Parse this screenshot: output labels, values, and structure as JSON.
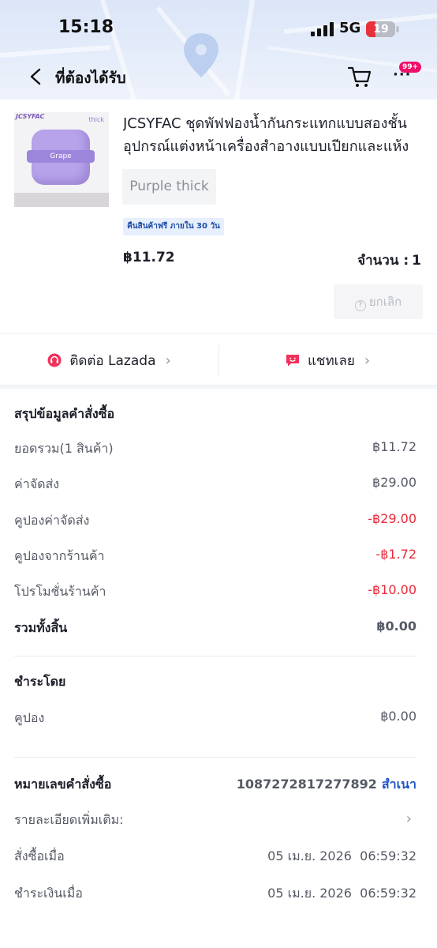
{
  "status_bar": {
    "time": "15:18",
    "network": "5G",
    "battery": "19"
  },
  "nav": {
    "title": "ที่ต้องได้รับ",
    "more_badge": "99+"
  },
  "product": {
    "image_brand": "JCSYFAC",
    "image_variant": "thick",
    "image_puff_label": "Grape",
    "title": "JCSYFAC ชุดพัฟฟองน้ำกันกระแทกแบบสองชั้น อุปกรณ์แต่งหน้าเครื่องสำอางแบบเปียกและแห้ง",
    "variant": "Purple thick",
    "return_tag": "คืนสินค้าฟรี ภายใน 30 วัน",
    "price": "฿11.72",
    "quantity_label": "จำนวน :",
    "quantity": "1",
    "cancel_label": "ยกเลิก"
  },
  "contact": {
    "lazada_label": "ติดต่อ Lazada",
    "chat_label": "แชทเลย"
  },
  "summary": {
    "title": "สรุปข้อมูลคำสั่งซื้อ",
    "rows": [
      {
        "label": "ยอดรวม(1 สินค้า)",
        "value": "฿11.72"
      },
      {
        "label": "ค่าจัดส่ง",
        "value": "฿29.00"
      },
      {
        "label": "คูปองค่าจัดส่ง",
        "value": "-฿29.00"
      },
      {
        "label": "คูปองจากร้านค้า",
        "value": "-฿1.72"
      },
      {
        "label": "โปรโมชั่นร้านค้า",
        "value": "-฿10.00"
      }
    ],
    "total_label": "รวมทั้งสิ้น",
    "total_value": "฿0.00"
  },
  "payment": {
    "title": "ชำระโดย",
    "method_label": "คูปอง",
    "method_value": "฿0.00"
  },
  "order": {
    "id_label": "หมายเลขคำสั่งซื้อ",
    "id_value": "1087272817277892",
    "copy_label": "สำเนา",
    "details_label": "รายละเอียดเพิ่มเติม:",
    "ordered_label": "สั่งซื้อเมื่อ",
    "ordered_value": "05 เม.ย. 2026  06:59:32",
    "paid_label": "ชำระเงินเมื่อ",
    "paid_value": "05 เม.ย. 2026  06:59:32"
  },
  "colors": {
    "accent_red": "#ea2a3a",
    "link_blue": "#1e55c9",
    "badge_pink": "#f0106a"
  }
}
